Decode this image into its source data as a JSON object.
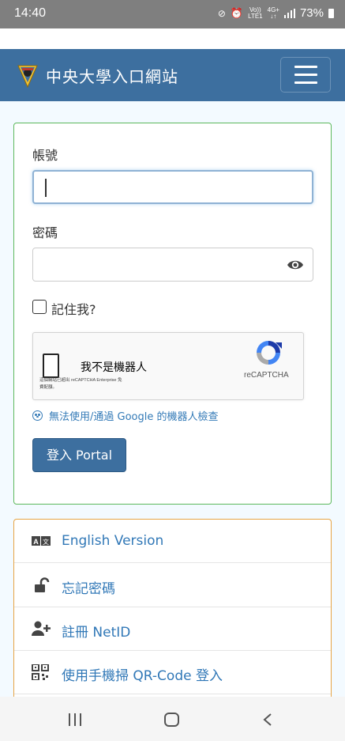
{
  "status_bar": {
    "time": "14:40",
    "network_top": "Vo))",
    "network_bottom": "LTE1",
    "data_top": "4G+",
    "data_bottom": "↓↑",
    "battery": "73%"
  },
  "header": {
    "title": "中央大學入口網站"
  },
  "login": {
    "account_label": "帳號",
    "account_value": "",
    "password_label": "密碼",
    "password_value": "",
    "remember_label": "記住我?",
    "recaptcha": {
      "checkbox_text": "我不是機器人",
      "brand": "reCAPTCHA",
      "note_line1": "這個網站已超出 reCAPTCHA Enterprise 免",
      "note_line2": "費配額。"
    },
    "help_link": "無法使用/通過 Google 的機器人檢查",
    "submit_label": "登入 Portal"
  },
  "links": [
    {
      "label": "English Version",
      "icon": "language-icon"
    },
    {
      "label": "忘記密碼",
      "icon": "unlock-icon"
    },
    {
      "label": "註冊 NetID",
      "icon": "user-plus-icon"
    },
    {
      "label": "使用手機掃 QR-Code 登入",
      "icon": "qrcode-icon"
    }
  ],
  "colors": {
    "navbar": "#3d6f9f",
    "login_border": "#5cb85c",
    "links_border": "#e6a443",
    "link_text": "#3178b7"
  }
}
